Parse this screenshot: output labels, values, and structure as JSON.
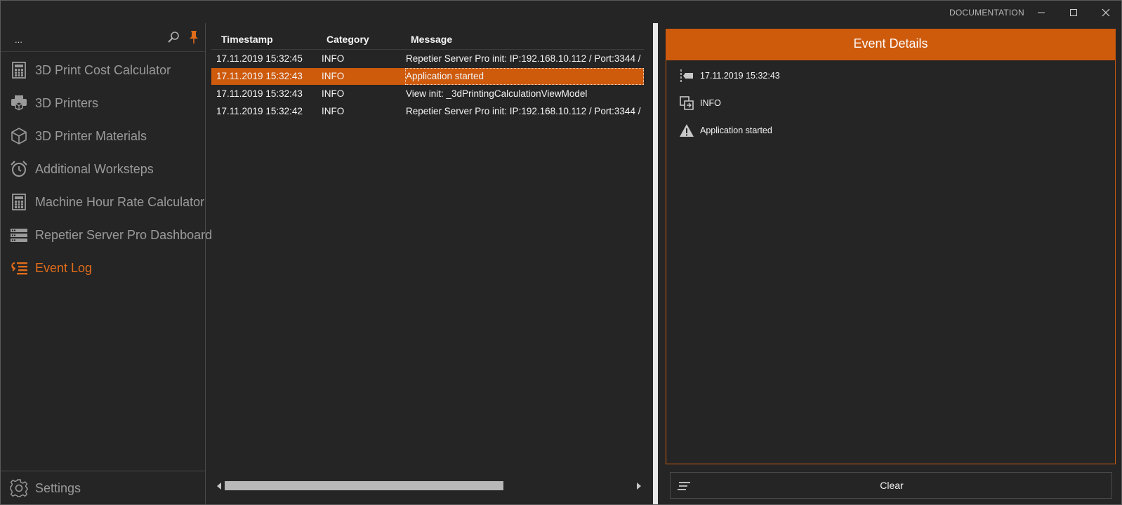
{
  "titlebar": {
    "documentation_label": "DOCUMENTATION"
  },
  "sidebar": {
    "search_text": "...",
    "items": [
      {
        "label": "3D Print Cost Calculator",
        "icon": "calculator-icon"
      },
      {
        "label": "3D Printers",
        "icon": "printer-icon"
      },
      {
        "label": "3D Printer Materials",
        "icon": "cube-icon"
      },
      {
        "label": "Additional Worksteps",
        "icon": "alarm-clock-icon"
      },
      {
        "label": "Machine Hour Rate Calculator",
        "icon": "calculator-icon"
      },
      {
        "label": "Repetier Server Pro Dashboard",
        "icon": "server-icon"
      },
      {
        "label": "Event Log",
        "icon": "event-log-icon",
        "active": true
      }
    ],
    "settings_label": "Settings"
  },
  "grid": {
    "columns": [
      "Timestamp",
      "Category",
      "Message"
    ],
    "rows": [
      {
        "timestamp": "17.11.2019 15:32:45",
        "category": "INFO",
        "message": "Repetier Server Pro init: IP:192.168.10.112 / Port:3344 / ..."
      },
      {
        "timestamp": "17.11.2019 15:32:43",
        "category": "INFO",
        "message": "Application started",
        "selected": true
      },
      {
        "timestamp": "17.11.2019 15:32:43",
        "category": "INFO",
        "message": "View init: _3dPrintingCalculationViewModel"
      },
      {
        "timestamp": "17.11.2019 15:32:42",
        "category": "INFO",
        "message": "Repetier Server Pro init: IP:192.168.10.112 / Port:3344 / ..."
      }
    ]
  },
  "details": {
    "title": "Event Details",
    "timestamp": "17.11.2019 15:32:43",
    "category": "INFO",
    "message": "Application started"
  },
  "actions": {
    "clear_label": "Clear"
  },
  "colors": {
    "accent": "#ce5a0c",
    "background": "#252525",
    "muted_text": "#9a9a9a"
  }
}
